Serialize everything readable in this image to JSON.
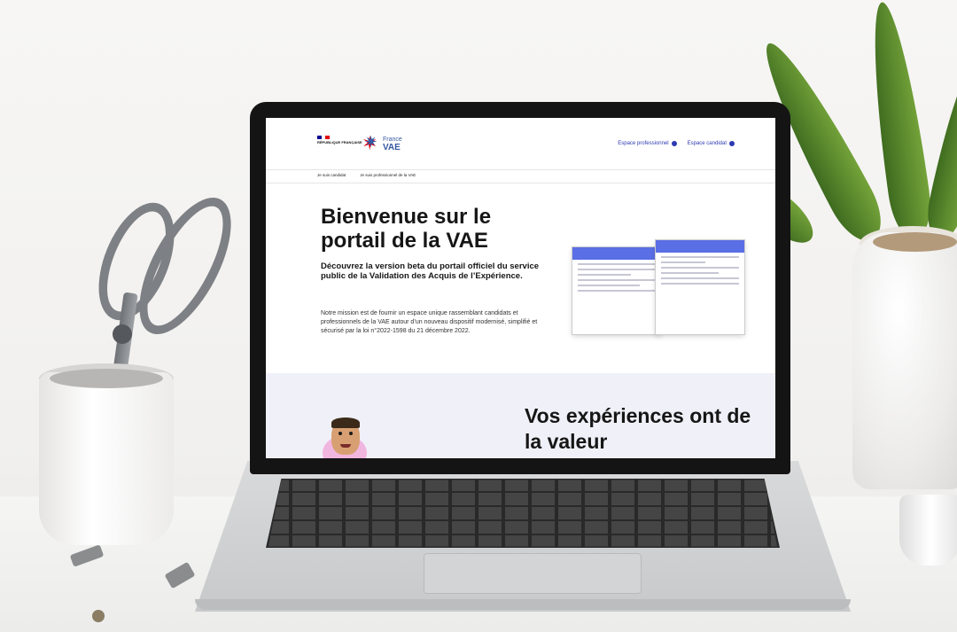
{
  "site": {
    "republique_label": "RÉPUBLIQUE FRANÇAISE",
    "logo_line1": "France",
    "logo_line2": "VAE"
  },
  "header": {
    "links": [
      {
        "label": "Espace professionnel",
        "icon": "user-icon"
      },
      {
        "label": "Espace candidat",
        "icon": "user-icon"
      }
    ]
  },
  "nav": {
    "items": [
      "Je suis candidat",
      "Je suis professionnel de la VAE"
    ]
  },
  "hero": {
    "title": "Bienvenue sur le portail de la VAE",
    "subtitle": "Découvrez la version beta du portail officiel du service public de la Validation des Acquis de l’Expérience.",
    "body": "Notre mission est de fournir un espace unique rassemblant candidats et professionnels de la VAE autour d’un nouveau dispositif modernisé, simplifié et sécurisé par la loi n°2022-1598 du 21 décembre 2022."
  },
  "section2": {
    "title": "Vos expériences ont de la valeur"
  },
  "colors": {
    "brand_blue": "#2c3ab3",
    "marianne_red": "#e1000f",
    "section_bg": "#f0f0f8"
  }
}
